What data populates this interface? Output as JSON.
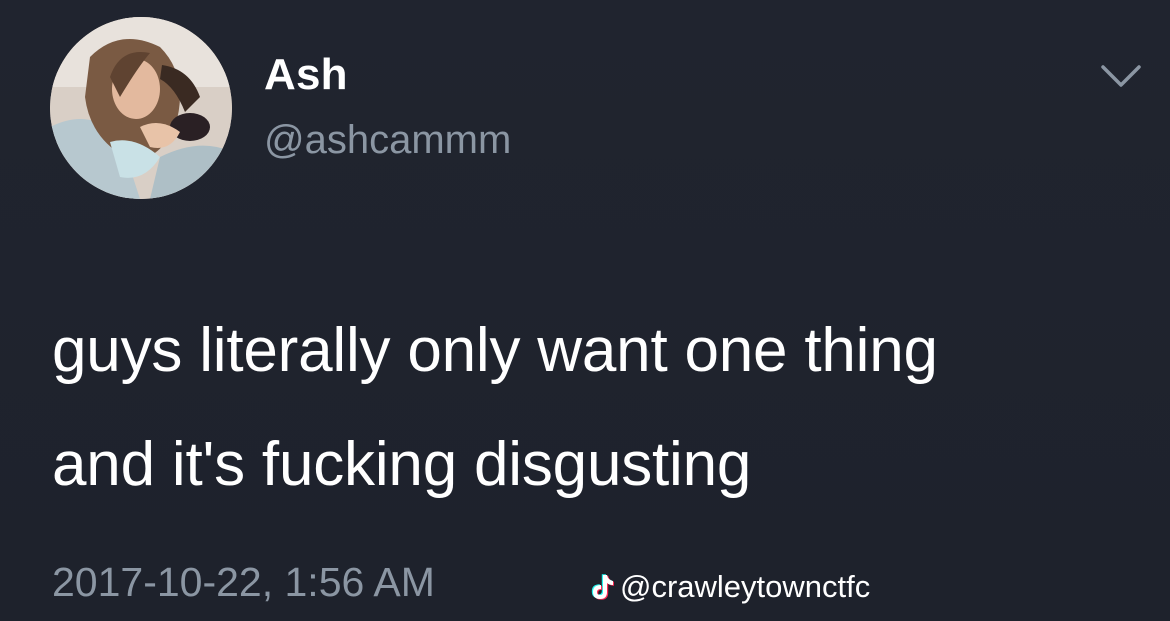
{
  "profile": {
    "display_name": "Ash",
    "handle": "@ashcammm",
    "avatar_icon": "avatar-icon"
  },
  "menu": {
    "icon": "chevron-down-icon"
  },
  "tweet": {
    "lines": [
      "guys literally only want one thing",
      "and it's fucking disgusting"
    ],
    "timestamp": "2017-10-22, 1:56 AM"
  },
  "watermark": {
    "icon": "tiktok-icon",
    "account": "@crawleytownctfc"
  },
  "colors": {
    "background": "#1f2430",
    "text": "#ffffff",
    "secondary_text": "#8b96a3"
  }
}
